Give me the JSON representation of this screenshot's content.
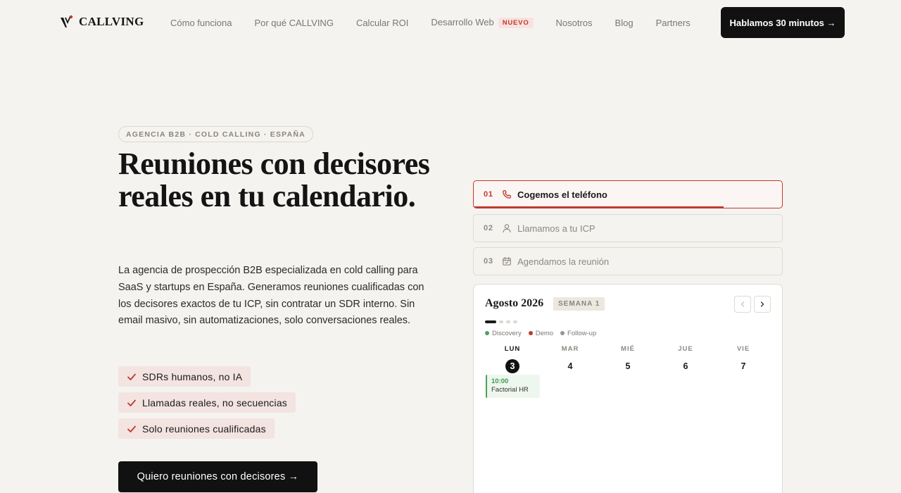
{
  "brand": {
    "name": "CALLVING",
    "accent": "#c1392b"
  },
  "nav": {
    "items": [
      {
        "label": "Cómo funciona"
      },
      {
        "label": "Por qué CALLVING"
      },
      {
        "label": "Calcular ROI"
      },
      {
        "label": "Desarrollo Web",
        "badge": "NUEVO"
      },
      {
        "label": "Nosotros"
      },
      {
        "label": "Blog"
      },
      {
        "label": "Partners"
      }
    ],
    "cta": "Hablamos 30 minutos →"
  },
  "hero": {
    "eyebrow": "AGENCIA B2B · COLD CALLING · ESPAÑA",
    "title": "Reuniones con decisores reales en tu calendario.",
    "description": "La agencia de prospección B2B especializada en cold calling para SaaS y startups en España. Generamos reuniones cualificadas con los decisores exactos de tu ICP, sin contratar un SDR interno. Sin email masivo, sin automatizaciones, solo conversaciones reales.",
    "features": [
      "SDRs humanos, no IA",
      "Llamadas reales, no secuencias",
      "Solo reuniones cualificadas"
    ],
    "cta": "Quiero reuniones con decisores →"
  },
  "steps": [
    {
      "num": "01",
      "label": "Cogemos el teléfono",
      "icon": "phone-icon",
      "active": true,
      "progress": 0.81
    },
    {
      "num": "02",
      "label": "Llamamos a tu ICP",
      "icon": "user-icon",
      "active": false
    },
    {
      "num": "03",
      "label": "Agendamos la reunión",
      "icon": "calendar-icon",
      "active": false
    }
  ],
  "calendar": {
    "month": "Agosto 2026",
    "week": "SEMANA 1",
    "legend": [
      {
        "label": "Discovery",
        "color": "#4aa35a"
      },
      {
        "label": "Demo",
        "color": "#c1392b"
      },
      {
        "label": "Follow-up",
        "color": "#9a948d"
      }
    ],
    "days": [
      {
        "name": "LUN",
        "num": "3",
        "today": true
      },
      {
        "name": "MAR",
        "num": "4"
      },
      {
        "name": "MIÉ",
        "num": "5"
      },
      {
        "name": "JUE",
        "num": "6"
      },
      {
        "name": "VIE",
        "num": "7"
      }
    ],
    "event": {
      "time": "10:00",
      "name": "Factorial HR",
      "type": "Discovery"
    }
  }
}
